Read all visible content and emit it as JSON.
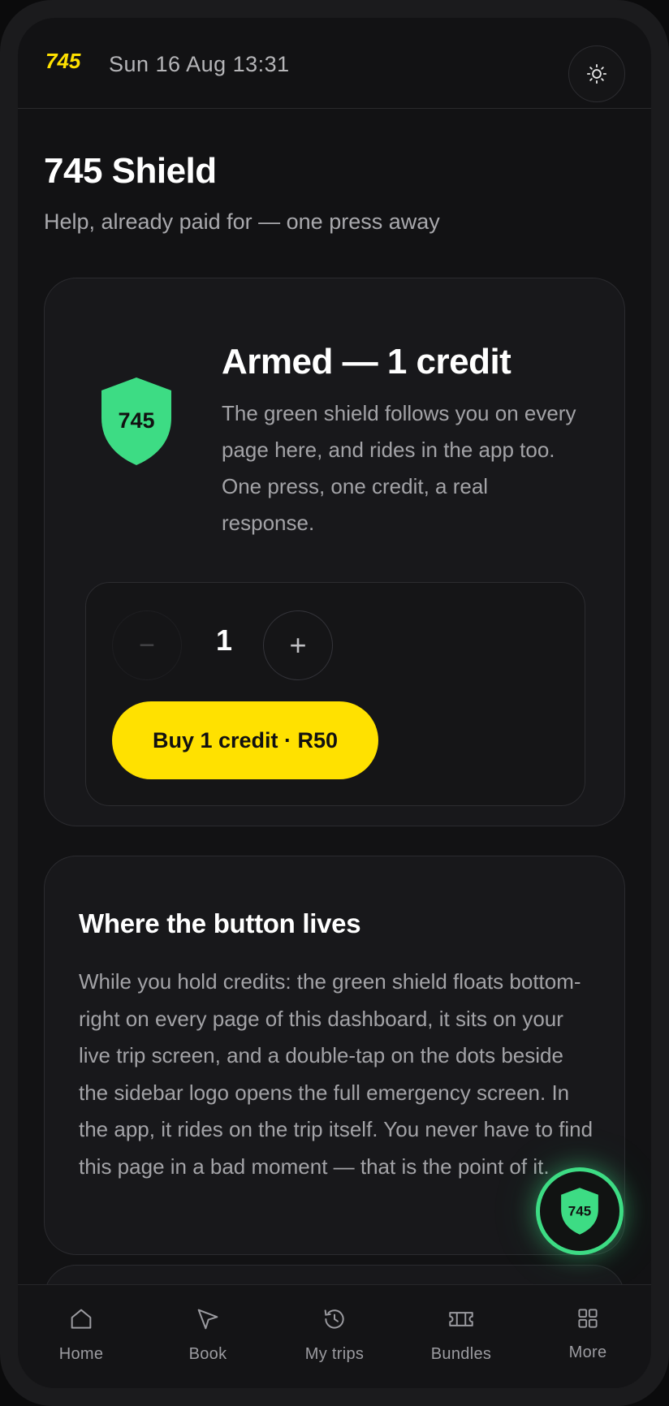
{
  "header": {
    "logo_text": "745",
    "datetime": "Sun 16 Aug 13:31",
    "theme_icon": "sun-icon"
  },
  "page": {
    "title": "745 Shield",
    "subtitle": "Help, already paid for — one press away"
  },
  "armed_card": {
    "shield_label": "745",
    "title": "Armed — 1 credit",
    "description": "The green shield follows you on every page here, and rides in the app too. One press, one credit, a real response.",
    "stepper": {
      "minus_symbol": "−",
      "value": "1",
      "plus_symbol": "+"
    },
    "buy_label": "Buy 1 credit · R50"
  },
  "where_card": {
    "title": "Where the button lives",
    "body": "While you hold credits: the green shield floats bottom-right on every page of this dashboard, it sits on your live trip screen, and a double-tap on the dots beside the sidebar logo opens the full emergency screen. In the app, it rides on the trip itself. You never have to find this page in a bad moment — that is the point of it."
  },
  "fab": {
    "label": "745"
  },
  "bottom_nav": [
    {
      "label": "Home",
      "icon": "home-icon"
    },
    {
      "label": "Book",
      "icon": "send-icon"
    },
    {
      "label": "My trips",
      "icon": "history-icon"
    },
    {
      "label": "Bundles",
      "icon": "ticket-icon"
    },
    {
      "label": "More",
      "icon": "grid-icon"
    }
  ],
  "colors": {
    "accent_yellow": "#ffe100",
    "shield_green": "#3ddc84",
    "background": "#121214",
    "card": "#18181b"
  }
}
